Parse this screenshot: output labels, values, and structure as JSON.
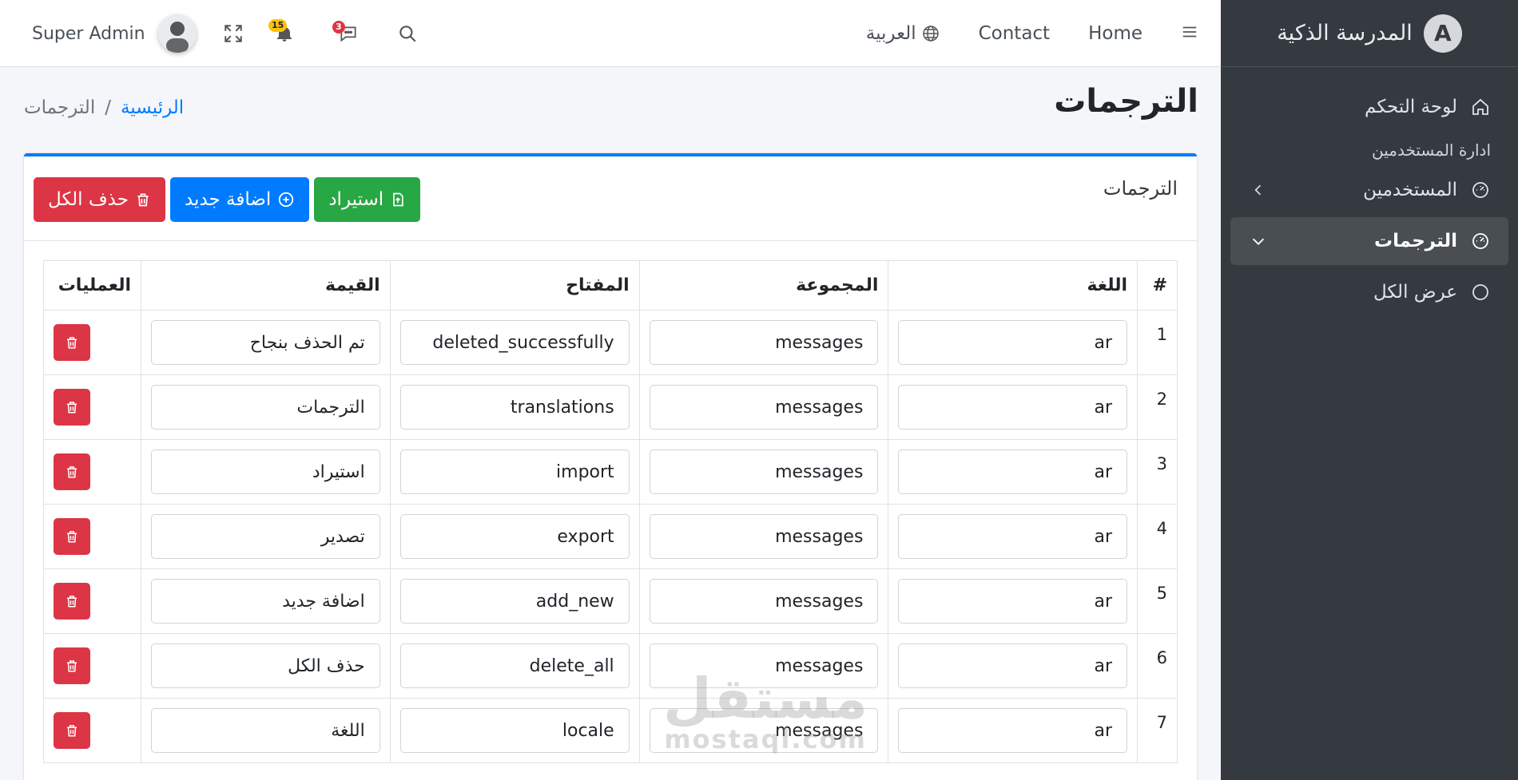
{
  "brand": {
    "name": "المدرسة الذكية",
    "logo_letter": "A"
  },
  "sidebar": {
    "dashboard": "لوحة التحكم",
    "section_header": "ادارة المستخدمين",
    "users": "المستخدمين",
    "translations": "الترجمات",
    "view_all": "عرض الكل"
  },
  "topbar": {
    "user_name": "Super Admin",
    "notifications_count": "15",
    "messages_count": "3",
    "language": "العربية",
    "contact": "Contact",
    "home": "Home"
  },
  "page": {
    "title": "الترجمات",
    "breadcrumb_home": "الرئيسية",
    "breadcrumb_sep": "/",
    "breadcrumb_current": "الترجمات"
  },
  "card": {
    "title": "الترجمات",
    "import_label": "استيراد",
    "add_new_label": "اضافة جديد",
    "delete_all_label": "حذف الكل"
  },
  "table": {
    "headers": {
      "num": "#",
      "locale": "اللغة",
      "group": "المجموعة",
      "key": "المفتاح",
      "value": "القيمة",
      "ops": "العمليات"
    },
    "rows": [
      {
        "num": "1",
        "locale": "ar",
        "group": "messages",
        "key": "deleted_successfully",
        "value": "تم الحذف بنجاح"
      },
      {
        "num": "2",
        "locale": "ar",
        "group": "messages",
        "key": "translations",
        "value": "الترجمات"
      },
      {
        "num": "3",
        "locale": "ar",
        "group": "messages",
        "key": "import",
        "value": "استيراد"
      },
      {
        "num": "4",
        "locale": "ar",
        "group": "messages",
        "key": "export",
        "value": "تصدير"
      },
      {
        "num": "5",
        "locale": "ar",
        "group": "messages",
        "key": "add_new",
        "value": "اضافة جديد"
      },
      {
        "num": "6",
        "locale": "ar",
        "group": "messages",
        "key": "delete_all",
        "value": "حذف الكل"
      },
      {
        "num": "7",
        "locale": "ar",
        "group": "messages",
        "key": "locale",
        "value": "اللغة"
      }
    ]
  },
  "watermark": {
    "text": "مستقل",
    "sub": "mostaql.com"
  }
}
